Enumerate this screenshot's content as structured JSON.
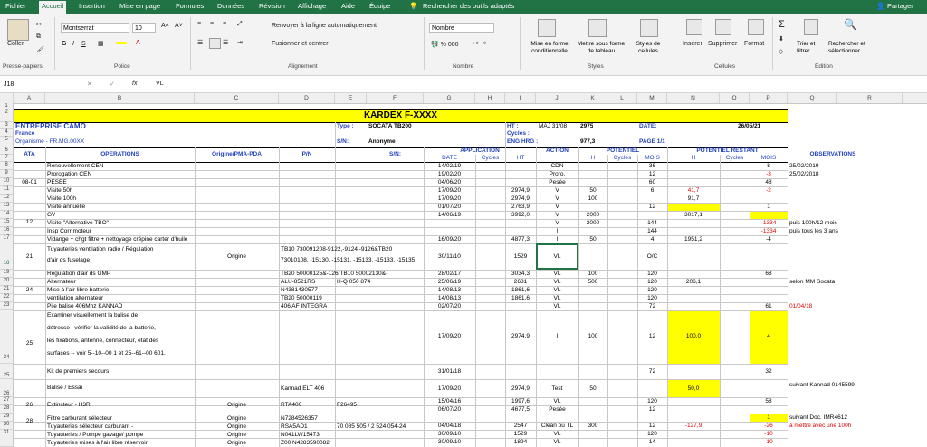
{
  "tabs": [
    "Fichier",
    "Accueil",
    "Insertion",
    "Mise en page",
    "Formules",
    "Données",
    "Révision",
    "Affichage",
    "Aide",
    "Équipe"
  ],
  "tell_me": "Rechercher des outils adaptés",
  "share": "Partager",
  "ribbon": {
    "paste": "Coller",
    "clipboard": "Presse-papiers",
    "font_name": "Montserrat",
    "font_size": "10",
    "police": "Police",
    "wrap": "Renvoyer à la ligne automatiquement",
    "merge": "Fusionner et centrer",
    "alignment": "Alignement",
    "number_format": "Nombre",
    "number": "Nombre",
    "cond": "Mise en forme conditionnelle",
    "table": "Mettre sous forme de tableau",
    "styles": "Styles de cellules",
    "styles_group": "Styles",
    "insert": "Insérer",
    "delete": "Supprimer",
    "format": "Format",
    "cells": "Cellules",
    "sort": "Trier et filtrer",
    "find": "Rechercher et sélectionner",
    "edit": "Édition"
  },
  "formula_bar": {
    "name_box": "J18",
    "fx": "fx",
    "value": "VL"
  },
  "columns": [
    "A",
    "B",
    "C",
    "D",
    "E",
    "F",
    "G",
    "H",
    "I",
    "J",
    "K",
    "L",
    "M",
    "N",
    "O",
    "P",
    "Q",
    "R"
  ],
  "rows": [
    "1",
    "2",
    "3",
    "4",
    "5",
    "6",
    "7",
    "8",
    "9",
    "10",
    "11",
    "12",
    "13",
    "14",
    "15",
    "16",
    "17",
    "18",
    "19",
    "20",
    "21",
    "22",
    "23",
    "24",
    "25",
    "26",
    "27",
    "28",
    "29",
    "30",
    "31"
  ],
  "header": {
    "kardex": "KARDEX   F-XXXX",
    "company": "ENTREPRISE CAMO",
    "country": "France",
    "org": "Organisme -   FR.MG.00XX",
    "type_l": "Type :",
    "type_v": "SOCATA TB200",
    "sn_l": "S/N:",
    "sn_v": "Anonyme",
    "ht_l": "HT :",
    "maj": "MAJ 31/08",
    "ht_v": "2975",
    "date_l": "DATE:",
    "date_v": "26/05/21",
    "cycles_l": "Cycles :",
    "eng_l": "ENG HRG :",
    "eng_v": "977,3",
    "page": "PAGE 1/1"
  },
  "col_titles": {
    "ata": "ATA",
    "ops": "OPERATIONS",
    "orig": "Origine/PMA-PDA",
    "pn": "P/N",
    "sn": "S/N:",
    "application": "APPLICATION",
    "date": "DATE",
    "cycles": "Cycles",
    "ht": "HT",
    "action": "ACTION",
    "pot": "POTENTIEL",
    "h": "H",
    "mois": "MOIS",
    "potr": "POTENTIEL RESTANT",
    "obs": "OBSERVATIONS"
  },
  "body": [
    {
      "ops": "Renouvellement CEN",
      "date": "14/02/19",
      "act": "CDN",
      "mois": "36",
      "rm": "8",
      "obs": "25/02/2019"
    },
    {
      "ops": "Prorogation CEN",
      "date": "19/02/20",
      "act": "Proro.",
      "mois": "12",
      "rm": "-3",
      "rmred": true,
      "obs": "25/02/2018"
    },
    {
      "ata": "08-01",
      "ops": "PESEE",
      "date": "04/06/20",
      "act": "Pesée",
      "mois": "60",
      "rm": "48"
    },
    {
      "ops": "Visite 50h",
      "date": "17/09/20",
      "ht": "2974,9",
      "act": "V",
      "h": "50",
      "mois": "6",
      "rh": "41,7",
      "rhred": true,
      "rm": "-2",
      "rmred": true
    },
    {
      "ops": "Visite 100h",
      "date": "17/09/20",
      "ht": "2974,9",
      "act": "V",
      "h": "100",
      "rh": "91,7",
      "rhyel": true
    },
    {
      "ops": "Visite annuelle",
      "date": "01/07/20",
      "ht": "2763,9",
      "act": "V",
      "mois": "12",
      "rm": "1",
      "rmyel": true
    },
    {
      "ops": "GV",
      "date": "14/06/19",
      "ht": "3992,0",
      "act": "V",
      "h": "2000",
      "rh": "3017,1"
    },
    {
      "ops": "Visite \"Alternative TBO\"",
      "act": "V",
      "h": "2000",
      "mois": "144",
      "rm": "-1334",
      "rmred": true,
      "obs": "puis 100h/12 mois"
    },
    {
      "ops": "Insp Corr moteur",
      "act": "I",
      "mois": "144",
      "rm": "-1334",
      "rmred": true,
      "obs": "puis tous les 3 ans"
    },
    {
      "ops": "Vidange + chgt filtre + nettoyage crépine carter d'huile",
      "date": "16/09/20",
      "ht": "4877,3",
      "act": "I",
      "h": "50",
      "mois": "4",
      "rh": "1951,2",
      "rm": "-4"
    }
  ],
  "body2": {
    "r18_ata": "21",
    "r18_ops1": "Tuyauteries ventilation radio / Régulation",
    "r18_ops2": "d'air ds fuselage",
    "r18_orig": "Origine",
    "r18_pn1": "TB10 730091208-9122,-9124,-9126&TB20",
    "r18_pn2": "73010108, -15130, -15131, -15133, -15133, -15135",
    "r18_date": "30/11/10",
    "r18_ht": "1529",
    "r18_act": "VL",
    "r18_mois": "O/C",
    "r19_ops": "Régulation d'air ds GMP",
    "r19_pn": "TB20 50000125&-126/TB10 50002130&-",
    "r19_date": "28/02/17",
    "r19_ht": "3034,3",
    "r19_act": "VL",
    "r19_h": "100",
    "r19_mois": "120",
    "r19_rm": "68",
    "r20_ops": "Alternateur",
    "r20_pn": "ALU-8521RS",
    "r20_sn": "H-Q 050 874",
    "r20_date": "25/06/19",
    "r20_ht": "2681",
    "r20_act": "VL",
    "r20_h": "500",
    "r20_mois": "120",
    "r20_rh": "206,1",
    "r20_obs": "selon MM Socata",
    "r21_ata": "24",
    "r21_ops": "Mise à l'air libre batterie",
    "r21_pn": "N4381430577",
    "r21_date": "14/08/13",
    "r21_ht": "1861,6",
    "r21_act": "VL",
    "r21_mois": "120",
    "r22_ops": "ventilation alternateur",
    "r22_pn": "TB20 50000119",
    "r22_date": "14/08/13",
    "r22_ht": "1861,6",
    "r22_act": "VL",
    "r22_mois": "120",
    "r23_ops": "Pile balise 406Mhz KANNAD",
    "r23_pn": "406 AF INTEGRA",
    "r23_date": "02/07/20",
    "r23_act": "VL",
    "r23_mois": "72",
    "r23_rm": "61",
    "r23_obs": "01/04/18",
    "r24_ops1": "Examiner visuellement la balise de",
    "r24_ops2": "détresse , vérifier la validité de la batterie,",
    "r24_ops3": "les fixations, antenne, connecteur, état des",
    "r24_ops4": "surfaces -- voir 5--10--00 1 et 25--61--00 601.",
    "r24_ata": "25",
    "r24_date": "17/09/20",
    "r24_ht": "2974,9",
    "r24_act": "I",
    "r24_h": "100",
    "r24_mois": "12",
    "r24_rh": "100,0",
    "r24_rm": "4",
    "r25_ops": "Kit de premiers secours",
    "r25_date": "31/01/18",
    "r25_mois": "72",
    "r25_rm": "32",
    "r26_ops": "Balise / Essai",
    "r26_pn": "Kannad ELT 406",
    "r26_date": "17/09/20",
    "r26_ht": "2974,9",
    "r26_act": "Test",
    "r26_h": "50",
    "r26_rh": "50,0",
    "r26_obs": "suivant Kannad 0145599",
    "r27_ata": "26",
    "r27_ops": "Extincteur  - H3R",
    "r27_orig": "Origine",
    "r27_pn": "RTA400",
    "r27_sn": "F26495",
    "r27_date": "15/04/16",
    "r27_ht": "1997,6",
    "r27_act": "VL",
    "r27_mois": "120",
    "r27_rm": "58",
    "r28_date": "06/07/20",
    "r28_ht": "4677,5",
    "r28_act": "Pesée",
    "r28_mois": "12",
    "r28_rm": "1",
    "r28_obs": "suivant Doc. IMR4612",
    "r29_ata": "28",
    "r29_ops": "Filtre carburant sélecteur",
    "r29_orig": "Origine",
    "r29_pn": "N7284526357",
    "r29_date": "04/04/18",
    "r29_ht": "2547",
    "r29_act": "Clean ou TL",
    "r29_h": "300",
    "r29_mois": "12",
    "r29_rh": "-127,9",
    "r29_rm": "-26",
    "r29_obs": "a mettre avec une 100h",
    "r30_ops": "Tuyauteries sélecteur carburant -",
    "r30_orig": "Origine",
    "r30_pn": "RSA5AD1",
    "r30_sn": "70 085 505 / 2 524 054-24",
    "r30_date": "30/09/10",
    "r30_ht": "1529",
    "r30_act": "VL",
    "r30_mois": "120",
    "r30_rm": "-10",
    "r31_ops": "Tuyauteries / Pompe gavage/ pompe",
    "r31_orig": "Origine",
    "r31_pn": "N041LW15473",
    "r31_date": "30/09/10",
    "r31_ht": "1894",
    "r31_act": "VL",
    "r31_mois": "14",
    "r31_rm": "-10",
    "r32_ops": "Tuyauteries mises à l'air libre réservoir",
    "r32_orig": "Origine",
    "r32_pn": "Z00 N4283590082",
    "r32_date": "30/09/10",
    "r32_ht": "1529",
    "r32_act": "VL",
    "r32_mois": "120",
    "r32_rm": "-10"
  }
}
